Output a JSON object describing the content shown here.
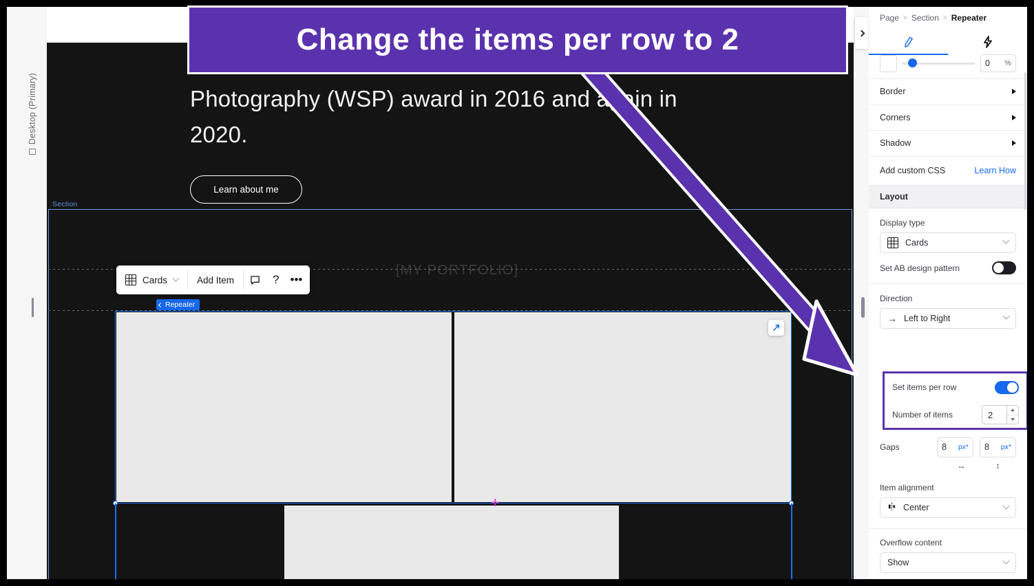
{
  "callout": {
    "text": "Change the items per row to 2"
  },
  "left_rail": {
    "device_label": "Desktop (Primary)",
    "device_icon": "monitor-icon"
  },
  "canvas": {
    "hero_paragraph": "Photography (WSP) award in 2016 and again in 2020.",
    "learn_button": "Learn about me",
    "section_tag": "Section",
    "portfolio_watermark": "[MY PORTFOLIO]",
    "repeater_tag": "Repeater",
    "toolbar": {
      "display_type": "Cards",
      "display_type_icon": "grid-icon",
      "add_item": "Add Item",
      "comment_icon": "comment-icon",
      "help_icon": "question-mark-icon",
      "more_icon": "ellipsis-icon"
    },
    "expand_icon": "expand-arrow-icon"
  },
  "inspector": {
    "breadcrumb": {
      "page": "Page",
      "section": "Section",
      "current": "Repeater",
      "separator": ">"
    },
    "tabs": {
      "design_icon": "brush-icon",
      "interactions_icon": "lightning-bolt-icon"
    },
    "opacity_row": {
      "value": "0",
      "unit": "%"
    },
    "accordions": [
      {
        "label": "Border"
      },
      {
        "label": "Corners"
      },
      {
        "label": "Shadow"
      }
    ],
    "custom_css": {
      "label": "Add custom CSS",
      "link": "Learn How"
    },
    "layout_header": "Layout",
    "display_type": {
      "label": "Display type",
      "value": "Cards",
      "icon": "grid-icon"
    },
    "ab_pattern": {
      "label": "Set AB design pattern",
      "state": "off"
    },
    "direction": {
      "label": "Direction",
      "value": "Left to Right",
      "icon": "arrow-right-icon"
    },
    "items_per_row": {
      "label": "Set items per row",
      "state": "on"
    },
    "number_of_items": {
      "label": "Number of items",
      "value": "2"
    },
    "gaps": {
      "label": "Gaps",
      "horizontal_value": "8",
      "horizontal_unit": "px*",
      "horizontal_icon": "↔",
      "vertical_value": "8",
      "vertical_unit": "px*",
      "vertical_icon": "↕"
    },
    "item_alignment": {
      "label": "Item alignment",
      "value": "Center",
      "icon": "align-center-icon"
    },
    "overflow_content": {
      "label": "Overflow content",
      "value": "Show"
    },
    "collapse_icon": "chevron-right-icon"
  },
  "colors": {
    "accent_purple": "#5B32AD",
    "accent_blue": "#1668EC",
    "canvas_dark": "#141414",
    "card_gray": "#E9E9E9"
  }
}
